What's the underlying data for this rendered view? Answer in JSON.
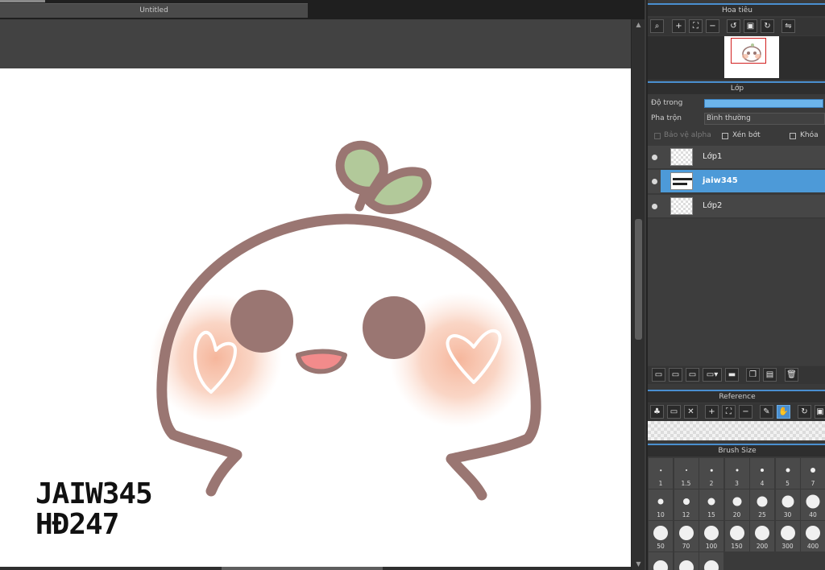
{
  "document": {
    "tab_title": "Untitled",
    "signature_lines": [
      "JAIW345",
      "HĐ247"
    ]
  },
  "navigator": {
    "title": "Hoa tiêu",
    "tools": [
      "zoom-fit-icon",
      "zoom-in-icon",
      "fit-screen-icon",
      "zoom-out-icon",
      "rotate-left-icon",
      "actual-size-icon",
      "rotate-right-icon",
      "flip-icon"
    ]
  },
  "layers": {
    "title": "Lớp",
    "opacity_label": "Độ trong",
    "opacity_value": 1.0,
    "blend_label": "Pha trộn",
    "blend_value": "Bình thường",
    "protect_alpha_label": "Bảo vệ alpha",
    "clipping_label": "Xén bớt",
    "lock_label": "Khóa",
    "items": [
      {
        "name": "Lớp1",
        "selected": false
      },
      {
        "name": "jaiw345",
        "selected": true
      },
      {
        "name": "Lớp2",
        "selected": false
      }
    ]
  },
  "reference": {
    "title": "Reference"
  },
  "brush_size": {
    "title": "Brush Size",
    "sizes": [
      "1",
      "1.5",
      "2",
      "3",
      "4",
      "5",
      "7",
      "10",
      "12",
      "15",
      "20",
      "25",
      "30",
      "40",
      "50",
      "70",
      "100",
      "150",
      "200",
      "300",
      "400",
      "",
      "",
      ""
    ]
  },
  "colors": {
    "accent": "#4d9ad8",
    "outline": "#9a7672",
    "leaf": "#b2c99a",
    "blush": "#f4b59a",
    "mouth": "#f28b8b"
  }
}
